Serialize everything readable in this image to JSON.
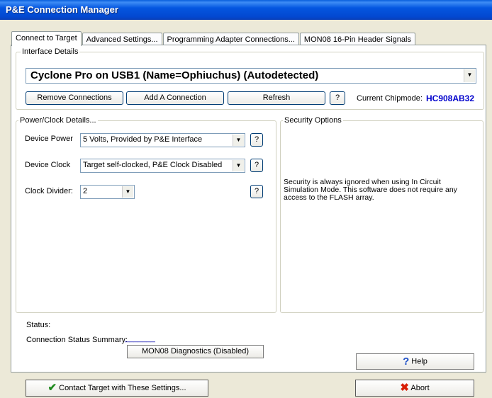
{
  "window": {
    "title": "P&E Connection Manager"
  },
  "tabs": [
    {
      "label": "Connect to Target"
    },
    {
      "label": "Advanced Settings..."
    },
    {
      "label": "Programming Adapter Connections..."
    },
    {
      "label": "MON08 16-Pin Header Signals"
    }
  ],
  "interface": {
    "group_title": "Interface Details",
    "selected": "Cyclone Pro on USB1 (Name=Ophiuchus) (Autodetected)",
    "remove_label": "Remove Connections",
    "add_label": "Add A Connection",
    "refresh_label": "Refresh",
    "help_label": "?",
    "chipmode_label": "Current Chipmode:",
    "chipmode_value": "HC908AB32"
  },
  "power": {
    "group_title": "Power/Clock Details...",
    "device_power_label": "Device Power",
    "device_power_value": "5 Volts, Provided by P&E Interface",
    "device_clock_label": "Device Clock",
    "device_clock_value": "Target self-clocked, P&E Clock Disabled",
    "divider_label": "Clock Divider:",
    "divider_value": "2",
    "help_label": "?"
  },
  "security": {
    "group_title": "Security Options",
    "text": "Security is always ignored when using In Circuit Simulation Mode. This software does not require any access to the FLASH array."
  },
  "status": {
    "label": "Status:",
    "summary_label": "Connection Status Summary:",
    "summary_value": "_______",
    "diagnostics_label": "MON08 Diagnostics (Disabled)"
  },
  "footer": {
    "help_label": "Help",
    "contact_label": "Contact Target with These Settings...",
    "abort_label": "Abort"
  },
  "colors": {
    "titlebar": "#0348d0",
    "chipmode": "#0000cc",
    "face": "#ece9d8"
  },
  "icons": {
    "contact": "checkmark-icon",
    "abort": "x-icon",
    "help": "question-icon",
    "dropdown": "chevron-down-icon"
  }
}
